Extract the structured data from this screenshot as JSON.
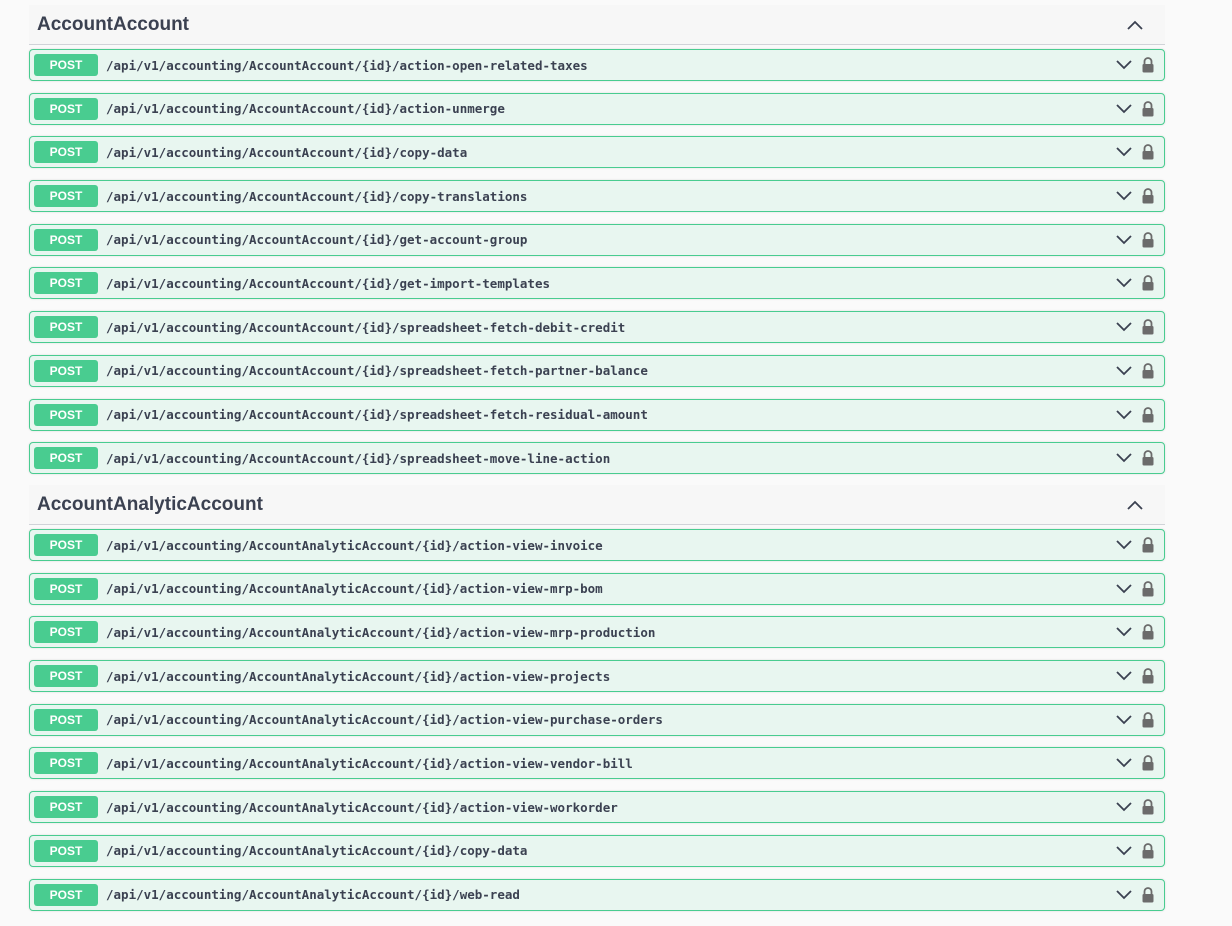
{
  "sections": [
    {
      "title": "AccountAccount",
      "operations": [
        {
          "method": "POST",
          "path": "/api/v1/accounting/AccountAccount/{id}/action-open-related-taxes"
        },
        {
          "method": "POST",
          "path": "/api/v1/accounting/AccountAccount/{id}/action-unmerge"
        },
        {
          "method": "POST",
          "path": "/api/v1/accounting/AccountAccount/{id}/copy-data"
        },
        {
          "method": "POST",
          "path": "/api/v1/accounting/AccountAccount/{id}/copy-translations"
        },
        {
          "method": "POST",
          "path": "/api/v1/accounting/AccountAccount/{id}/get-account-group"
        },
        {
          "method": "POST",
          "path": "/api/v1/accounting/AccountAccount/{id}/get-import-templates"
        },
        {
          "method": "POST",
          "path": "/api/v1/accounting/AccountAccount/{id}/spreadsheet-fetch-debit-credit"
        },
        {
          "method": "POST",
          "path": "/api/v1/accounting/AccountAccount/{id}/spreadsheet-fetch-partner-balance"
        },
        {
          "method": "POST",
          "path": "/api/v1/accounting/AccountAccount/{id}/spreadsheet-fetch-residual-amount"
        },
        {
          "method": "POST",
          "path": "/api/v1/accounting/AccountAccount/{id}/spreadsheet-move-line-action"
        }
      ]
    },
    {
      "title": "AccountAnalyticAccount",
      "operations": [
        {
          "method": "POST",
          "path": "/api/v1/accounting/AccountAnalyticAccount/{id}/action-view-invoice"
        },
        {
          "method": "POST",
          "path": "/api/v1/accounting/AccountAnalyticAccount/{id}/action-view-mrp-bom"
        },
        {
          "method": "POST",
          "path": "/api/v1/accounting/AccountAnalyticAccount/{id}/action-view-mrp-production"
        },
        {
          "method": "POST",
          "path": "/api/v1/accounting/AccountAnalyticAccount/{id}/action-view-projects"
        },
        {
          "method": "POST",
          "path": "/api/v1/accounting/AccountAnalyticAccount/{id}/action-view-purchase-orders"
        },
        {
          "method": "POST",
          "path": "/api/v1/accounting/AccountAnalyticAccount/{id}/action-view-vendor-bill"
        },
        {
          "method": "POST",
          "path": "/api/v1/accounting/AccountAnalyticAccount/{id}/action-view-workorder"
        },
        {
          "method": "POST",
          "path": "/api/v1/accounting/AccountAnalyticAccount/{id}/copy-data"
        },
        {
          "method": "POST",
          "path": "/api/v1/accounting/AccountAnalyticAccount/{id}/web-read"
        }
      ]
    }
  ],
  "icons": {
    "collapse": "caret-up-icon",
    "expand": "chevron-down-icon",
    "auth": "lock-icon"
  },
  "colors": {
    "post_accent": "#49cc90",
    "post_background": "#e8f6f0",
    "text": "#3b4151"
  }
}
